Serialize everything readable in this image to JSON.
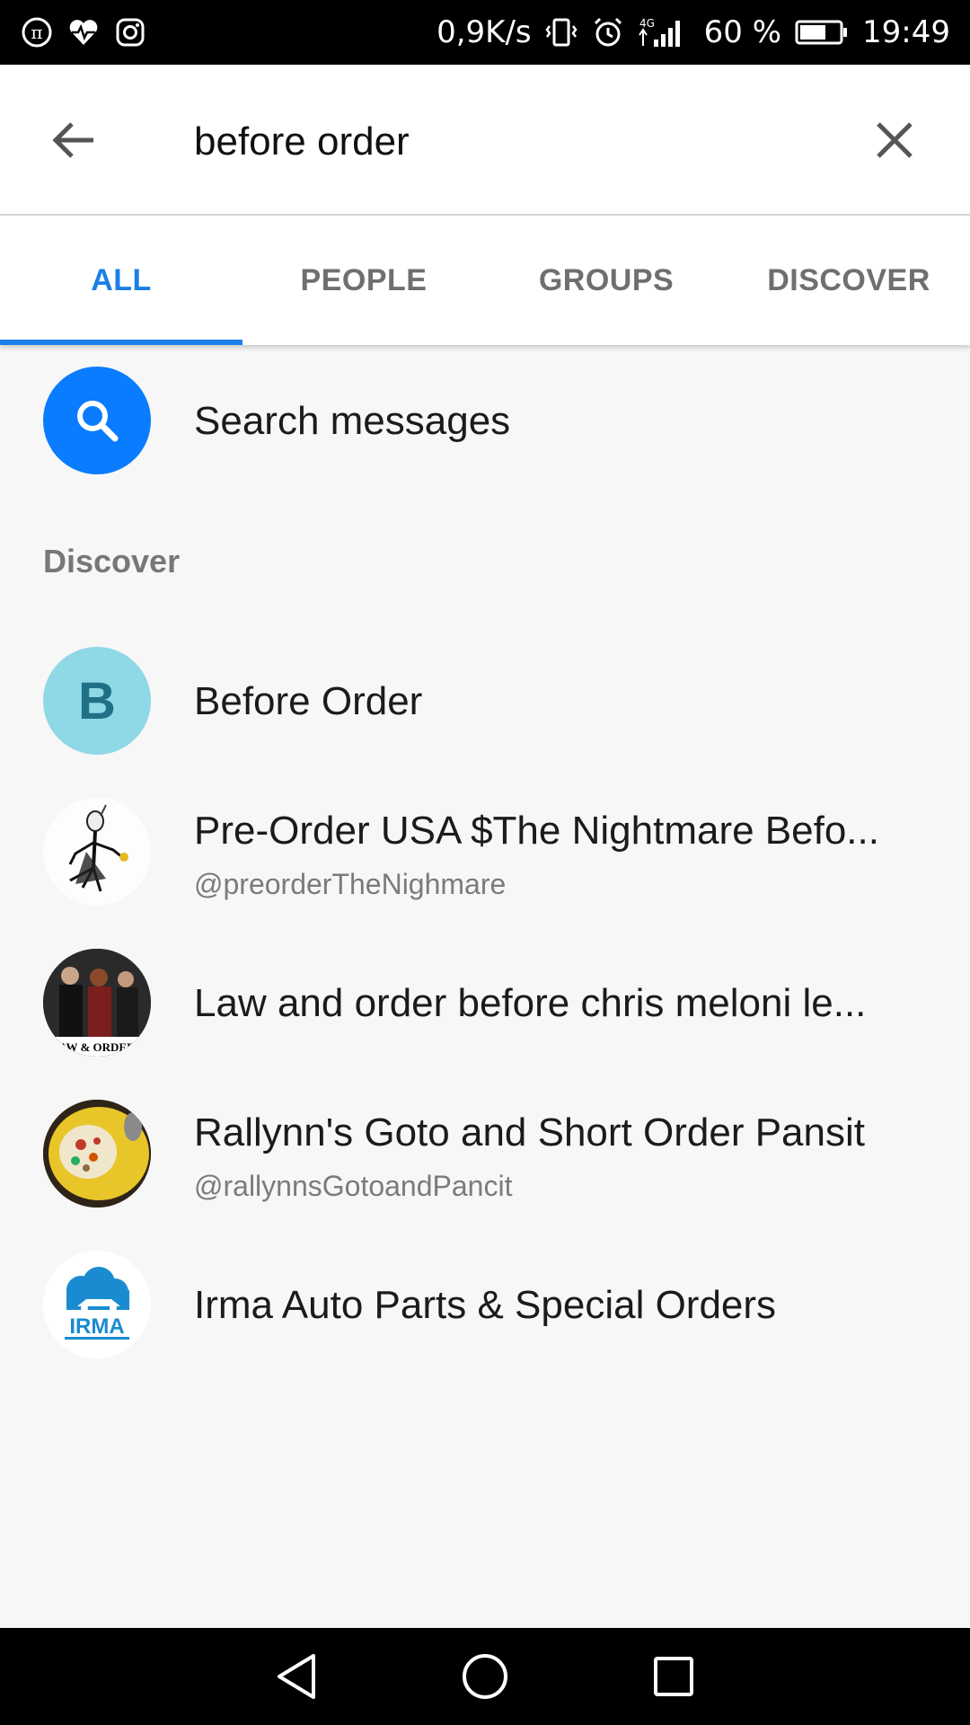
{
  "status_bar": {
    "network_speed": "0,9K/s",
    "signal_label": "4G",
    "battery_percent": "60 %",
    "time": "19:49",
    "icons_left": [
      "pi-icon",
      "heart-monitor-icon",
      "instagram-icon"
    ],
    "icons_right": [
      "vibrate-icon",
      "alarm-icon",
      "signal-icon",
      "battery-icon"
    ]
  },
  "search": {
    "query": "before order"
  },
  "tabs": [
    {
      "label": "ALL",
      "active": true
    },
    {
      "label": "PEOPLE",
      "active": false
    },
    {
      "label": "GROUPS",
      "active": false
    },
    {
      "label": "DISCOVER",
      "active": false
    }
  ],
  "search_messages": {
    "label": "Search messages"
  },
  "discover": {
    "section_label": "Discover",
    "items": [
      {
        "title": "Before Order",
        "subtitle": "",
        "avatar_letter": "B"
      },
      {
        "title": "Pre-Order USA $The Nightmare Befo...",
        "subtitle": "@preorderTheNighmare"
      },
      {
        "title": "Law and order before chris meloni le...",
        "subtitle": "",
        "avatar_caption": "AW & ORDER"
      },
      {
        "title": "Rallynn's Goto and Short Order Pansit",
        "subtitle": "@rallynnsGotoandPancit"
      },
      {
        "title": "Irma Auto Parts & Special Orders",
        "subtitle": "",
        "avatar_caption": "IRMA"
      }
    ]
  },
  "colors": {
    "accent": "#1a7fe6",
    "search_circle": "#0a7cff",
    "before_order_avatar": "#8fd8e6",
    "before_order_letter": "#1f6f86",
    "irma_blue": "#1a8bd0"
  }
}
